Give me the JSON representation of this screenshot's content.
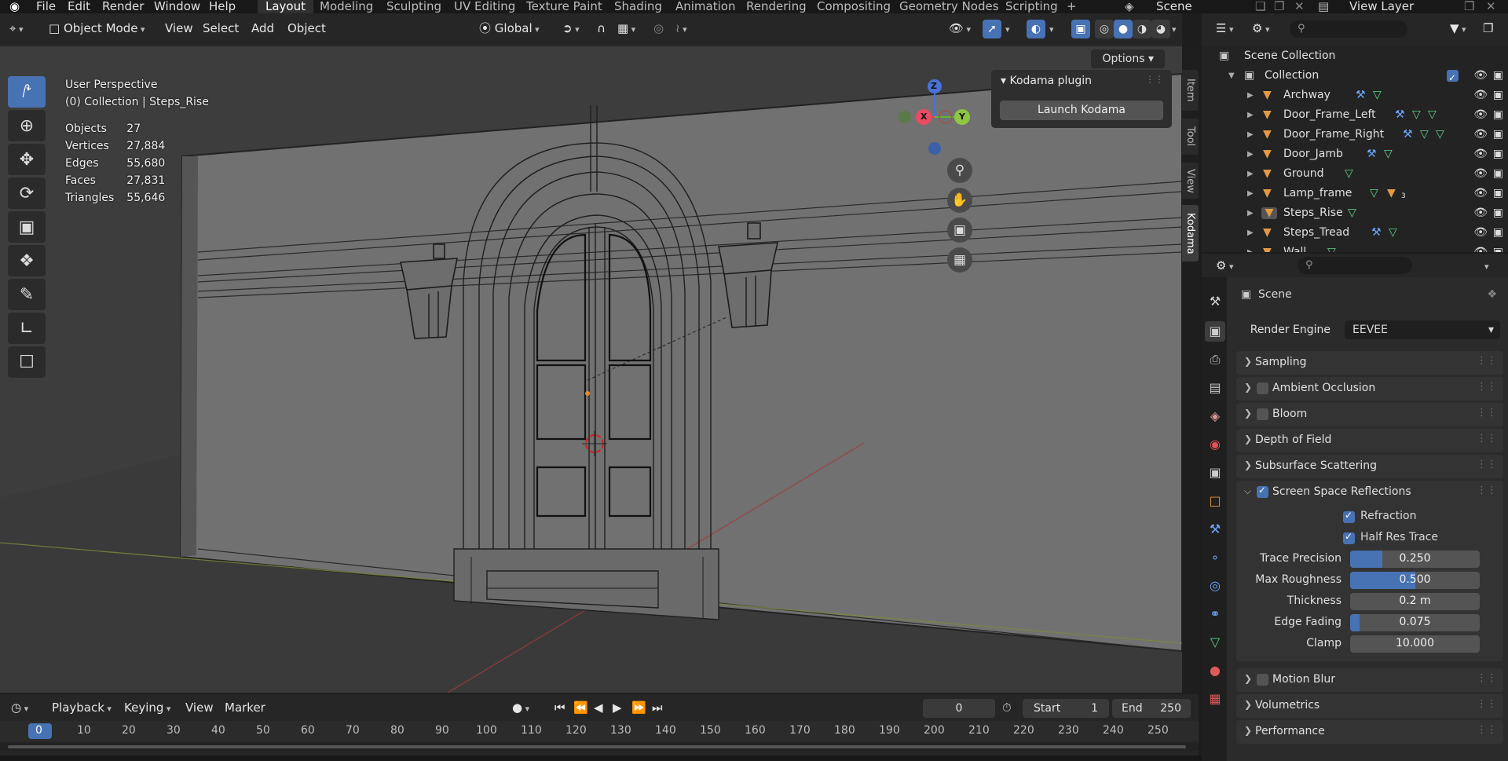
{
  "menu": {
    "file": "File",
    "edit": "Edit",
    "render": "Render",
    "window": "Window",
    "help": "Help"
  },
  "workspaces": [
    "Layout",
    "Modeling",
    "Sculpting",
    "UV Editing",
    "Texture Paint",
    "Shading",
    "Animation",
    "Rendering",
    "Compositing",
    "Geometry Nodes",
    "Scripting"
  ],
  "workspace_add": "+",
  "scene_name": "Scene",
  "view_layer": "View Layer",
  "viewport_header": {
    "mode": "Object Mode",
    "view": "View",
    "select": "Select",
    "add": "Add",
    "object": "Object",
    "transform_orientation": "Global",
    "options": "Options"
  },
  "overlay_text": {
    "perspective": "User Perspective",
    "collection_line": "(0) Collection | Steps_Rise",
    "stats": [
      {
        "label": "Objects",
        "value": "27"
      },
      {
        "label": "Vertices",
        "value": "27,884"
      },
      {
        "label": "Edges",
        "value": "55,680"
      },
      {
        "label": "Faces",
        "value": "27,831"
      },
      {
        "label": "Triangles",
        "value": "55,646"
      }
    ]
  },
  "gizmo": {
    "z": "Z",
    "x": "X",
    "y": "Y"
  },
  "kodama_panel": {
    "title": "Kodama plugin",
    "button": "Launch Kodama"
  },
  "sidebar_tabs": [
    "Item",
    "Tool",
    "View",
    "Kodama"
  ],
  "timeline": {
    "playback": "Playback",
    "keying": "Keying",
    "view": "View",
    "marker": "Marker",
    "current_frame": "0",
    "start_label": "Start",
    "start": "1",
    "end_label": "End",
    "end": "250",
    "ticks": [
      "0",
      "10",
      "20",
      "30",
      "40",
      "50",
      "60",
      "70",
      "80",
      "90",
      "100",
      "110",
      "120",
      "130",
      "140",
      "150",
      "160",
      "170",
      "180",
      "190",
      "200",
      "210",
      "220",
      "230",
      "240",
      "250"
    ]
  },
  "outliner": {
    "scene_collection": "Scene Collection",
    "collection": "Collection",
    "objects": [
      {
        "name": "Archway"
      },
      {
        "name": "Door_Frame_Left"
      },
      {
        "name": "Door_Frame_Right"
      },
      {
        "name": "Door_Jamb"
      },
      {
        "name": "Ground"
      },
      {
        "name": "Lamp_frame",
        "badge": "3"
      },
      {
        "name": "Steps_Rise"
      },
      {
        "name": "Steps_Tread"
      },
      {
        "name": "Wall"
      }
    ]
  },
  "properties": {
    "context": "Scene",
    "render_engine_label": "Render Engine",
    "render_engine": "EEVEE",
    "panels": {
      "sampling": "Sampling",
      "ambient_occlusion": "Ambient Occlusion",
      "bloom": "Bloom",
      "depth_of_field": "Depth of Field",
      "subsurface_scattering": "Subsurface Scattering",
      "ssr": "Screen Space Reflections",
      "motion_blur": "Motion Blur",
      "volumetrics": "Volumetrics",
      "performance": "Performance"
    },
    "ssr": {
      "refraction": "Refraction",
      "half_res_trace": "Half Res Trace",
      "trace_precision_label": "Trace Precision",
      "trace_precision": "0.250",
      "trace_precision_fill": 0.25,
      "max_roughness_label": "Max Roughness",
      "max_roughness": "0.500",
      "max_roughness_fill": 0.5,
      "thickness_label": "Thickness",
      "thickness": "0.2 m",
      "edge_fading_label": "Edge Fading",
      "edge_fading": "0.075",
      "edge_fading_fill": 0.075,
      "clamp_label": "Clamp",
      "clamp": "10.000"
    }
  },
  "colors": {
    "accent": "#4772b3",
    "mesh_icon": "#e39a45",
    "modifier_icon": "#6fa8ff",
    "data_icon": "#5fd38b"
  }
}
